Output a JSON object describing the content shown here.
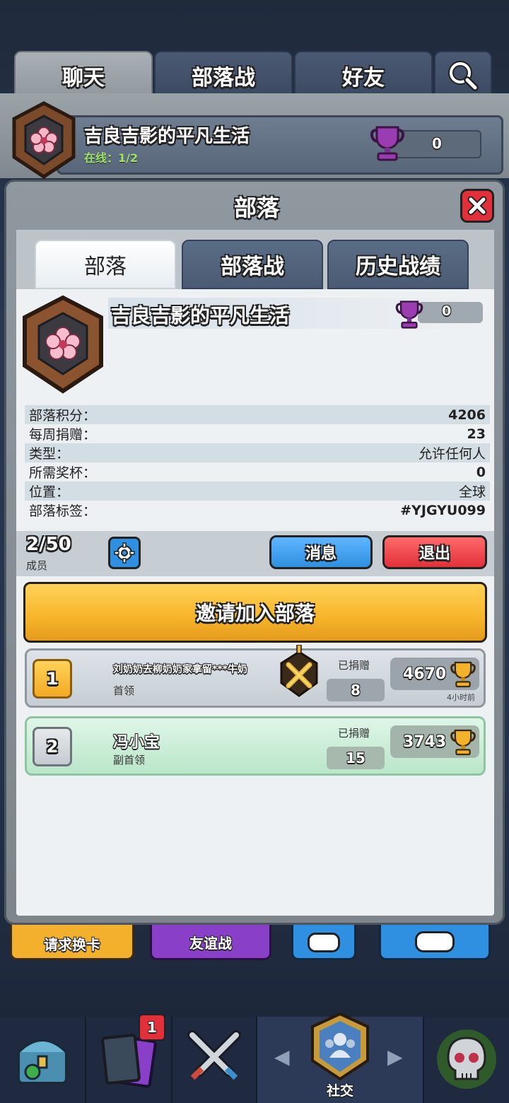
{
  "top_tabs": [
    "聊天",
    "部落战",
    "好友"
  ],
  "header_clan": {
    "name": "吉良吉影的平凡生活",
    "online": "在线：1/2",
    "trophies": "0"
  },
  "background_buttons": {
    "request": "请求换卡",
    "friendly_battle": "友谊战"
  },
  "modal": {
    "title": "部落",
    "tabs": [
      "部落",
      "部落战",
      "历史战绩"
    ],
    "clan": {
      "name": "吉良吉影的平凡生活",
      "trophies": "0"
    },
    "info": [
      {
        "label": "部落积分：",
        "value": "4206"
      },
      {
        "label": "每周捐赠：",
        "value": "23"
      },
      {
        "label": "类型：",
        "value": "允许任何人"
      },
      {
        "label": "所需奖杯：",
        "value": "0"
      },
      {
        "label": "位置：",
        "value": "全球"
      },
      {
        "label": "部落标签：",
        "value": "#YJGYU099"
      }
    ],
    "members_count": "2/50",
    "members_label": "成员",
    "message_button": "消息",
    "leave_button": "退出",
    "invite_button": "邀请加入部落",
    "members": [
      {
        "rank": "1",
        "name": "刘奶奶去柳奶奶家拿留***牛奶",
        "role": "首领",
        "donated_label": "已捐赠",
        "donated": "8",
        "trophies": "4670",
        "last_seen": "4小时前"
      },
      {
        "rank": "2",
        "name": "冯小宝",
        "role": "副首领",
        "donated_label": "已捐赠",
        "donated": "15",
        "trophies": "3743"
      }
    ]
  },
  "bottom_nav": {
    "social_label": "社交",
    "cards_badge": "1"
  },
  "colors": {
    "accent_blue": "#2f8fe0",
    "leave_red": "#e2303a",
    "invite_orange": "#f7b42a",
    "member_green": "#c9eed6"
  }
}
